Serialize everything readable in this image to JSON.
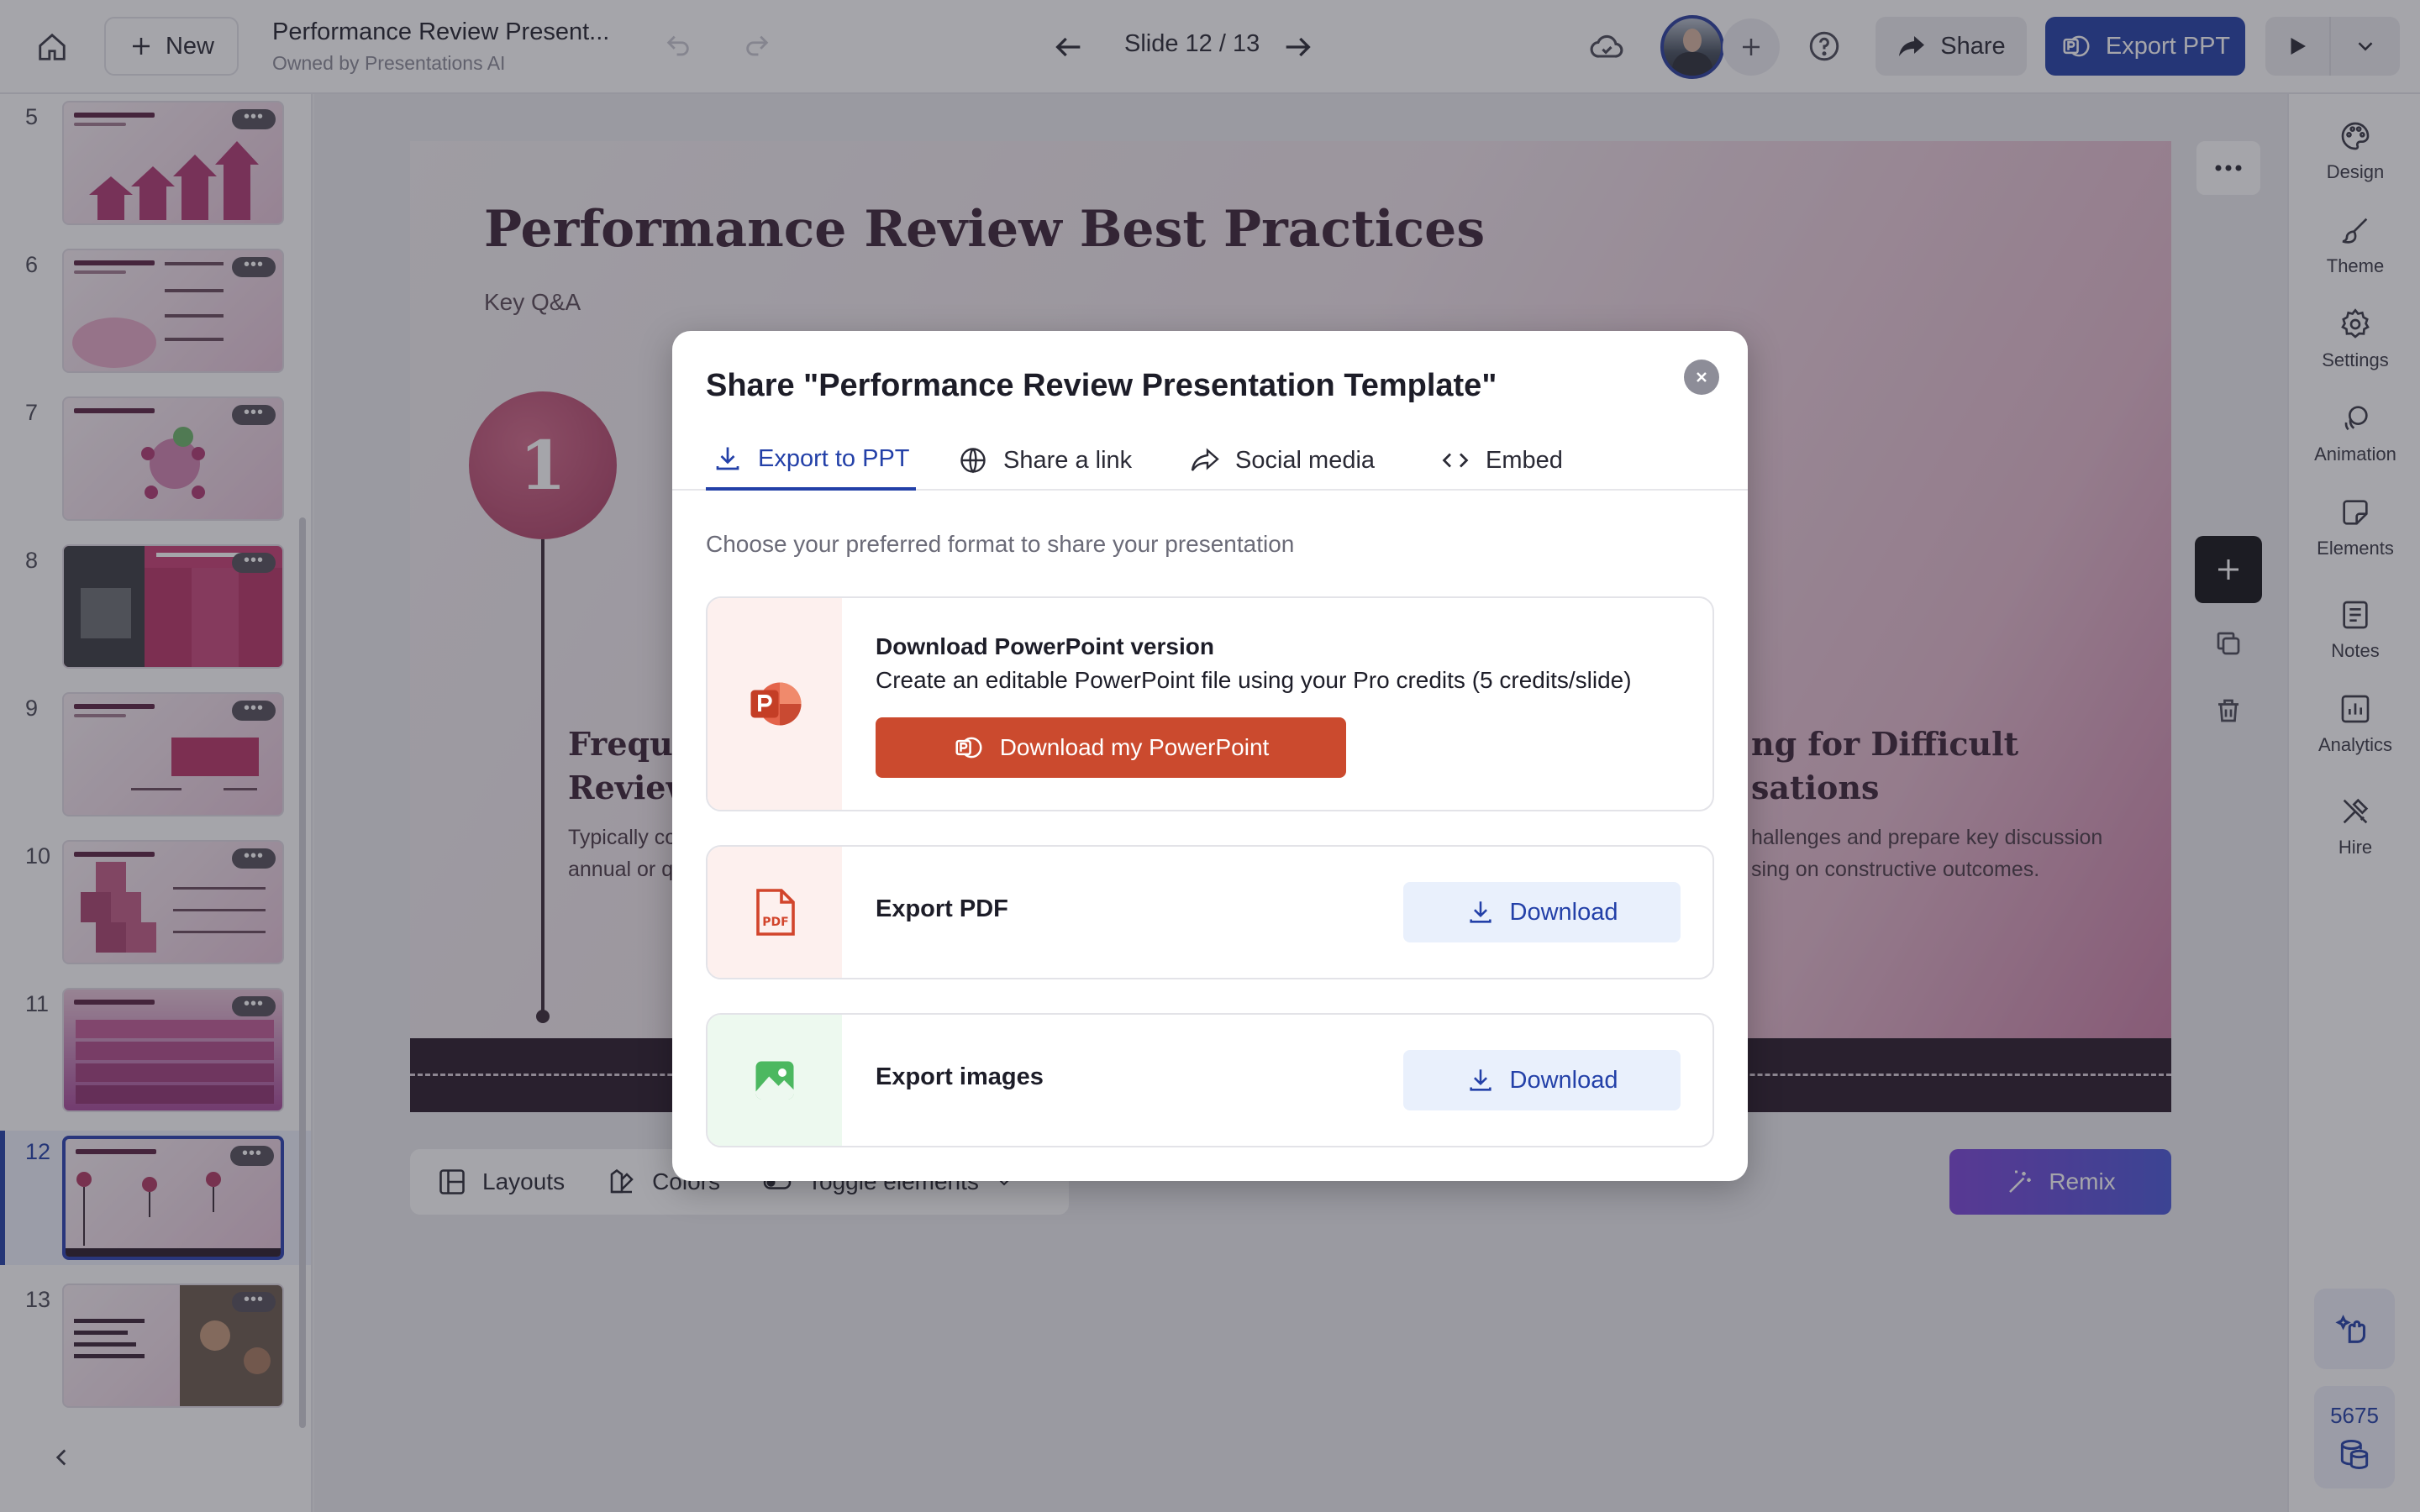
{
  "topbar": {
    "new_label": "New",
    "doc_title": "Performance Review Present...",
    "doc_owner": "Owned by Presentations AI",
    "slide_counter": "Slide 12 / 13",
    "share_label": "Share",
    "export_label": "Export PPT"
  },
  "thumbnails": [
    {
      "number": "5"
    },
    {
      "number": "6"
    },
    {
      "number": "7"
    },
    {
      "number": "8"
    },
    {
      "number": "9"
    },
    {
      "number": "10"
    },
    {
      "number": "11"
    },
    {
      "number": "12"
    },
    {
      "number": "13"
    }
  ],
  "slide": {
    "title": "Performance Review Best Practices",
    "subtitle": "Key Q&A",
    "step_number": "1",
    "left_heading_line1": "Freque",
    "left_heading_line2": "Review",
    "left_text_line1": "Typically co",
    "left_text_line2": "annual or q",
    "right_heading_line1": "ng for Difficult",
    "right_heading_line2": "sations",
    "right_text_line1": "hallenges and prepare key discussion",
    "right_text_line2": "sing on constructive outcomes."
  },
  "bottom_tools": {
    "layouts": "Layouts",
    "colors": "Colors",
    "toggle": "Toggle elements",
    "remix": "Remix"
  },
  "right_bar": {
    "design": "Design",
    "theme": "Theme",
    "settings": "Settings",
    "animation": "Animation",
    "elements": "Elements",
    "notes": "Notes",
    "analytics": "Analytics",
    "hire": "Hire",
    "credits": "5675"
  },
  "modal": {
    "title": "Share \"Performance Review Presentation Template\"",
    "tabs": [
      "Export to PPT",
      "Share a link",
      "Social media",
      "Embed"
    ],
    "description": "Choose your preferred format to share your presentation",
    "ppt_card": {
      "title": "Download PowerPoint version",
      "subtitle": "Create an editable PowerPoint file using your Pro credits (5 credits/slide)",
      "button": "Download my PowerPoint"
    },
    "pdf_card": {
      "label": "Export PDF",
      "button": "Download"
    },
    "images_card": {
      "label": "Export images",
      "button": "Download"
    }
  },
  "colors": {
    "accent": "#2340a8",
    "ppt_orange": "#cb4a2e",
    "slide_accent": "#a93b61"
  }
}
